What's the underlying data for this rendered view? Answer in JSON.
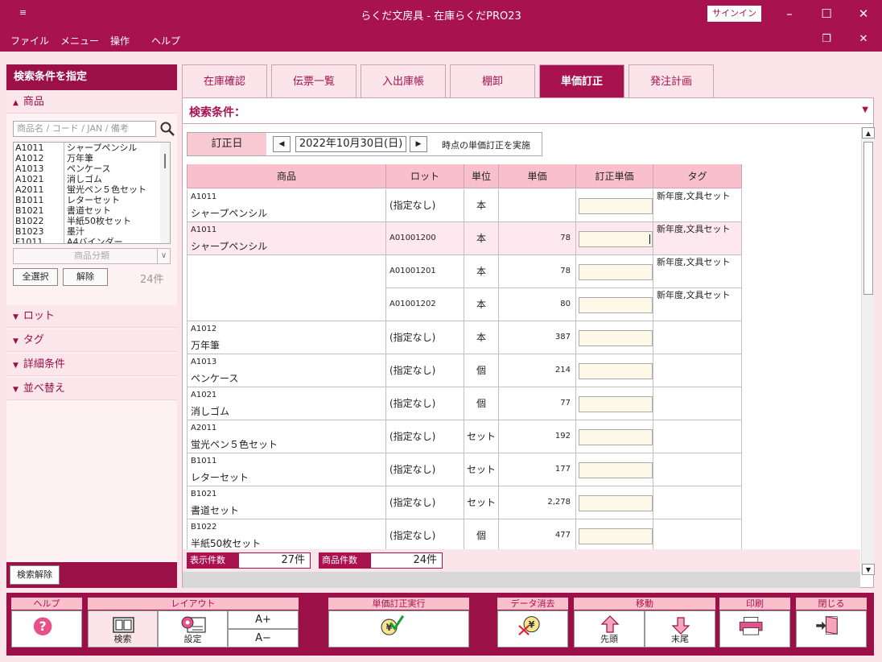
{
  "window": {
    "title": "らくだ文房具 - 在庫らくだPRO23",
    "signin_label": "サインイン",
    "system_glyph": "≡"
  },
  "menu": [
    "ファイル",
    "メニュー",
    "操作",
    "ヘルプ"
  ],
  "left_panel": {
    "header": "検索条件を指定",
    "product_section": "商品",
    "search_placeholder": "商品名 / コード / JAN / 備考",
    "products": [
      {
        "code": "A1011",
        "name": "シャープペンシル"
      },
      {
        "code": "A1012",
        "name": "万年筆"
      },
      {
        "code": "A1013",
        "name": "ペンケース"
      },
      {
        "code": "A1021",
        "name": "消しゴム"
      },
      {
        "code": "A2011",
        "name": "蛍光ペン５色セット"
      },
      {
        "code": "B1011",
        "name": "レターセット"
      },
      {
        "code": "B1021",
        "name": "書道セット"
      },
      {
        "code": "B1022",
        "name": "半紙50枚セット"
      },
      {
        "code": "B1023",
        "name": "墨汁"
      },
      {
        "code": "F1011",
        "name": "A4バインダー"
      }
    ],
    "category_placeholder": "商品分類",
    "select_all": "全選択",
    "clear": "解除",
    "count": "24件",
    "sections": [
      "ロット",
      "タグ",
      "詳細条件",
      "並べ替え"
    ],
    "clear_search": "検索解除"
  },
  "tabs": [
    {
      "label": "在庫確認",
      "active": false
    },
    {
      "label": "伝票一覧",
      "active": false
    },
    {
      "label": "入出庫帳",
      "active": false
    },
    {
      "label": "棚卸",
      "active": false
    },
    {
      "label": "単価訂正",
      "active": true
    },
    {
      "label": "発注計画",
      "active": false
    }
  ],
  "main": {
    "condition_label": "検索条件：",
    "date_label": "訂正日",
    "date_value": "2022年10月30日(日)",
    "date_note": "時点の単価訂正を実施",
    "columns": [
      "商品",
      "ロット",
      "単位",
      "単価",
      "訂正単価",
      "タグ"
    ],
    "rows": [
      {
        "code": "A1011",
        "name": "シャープペンシル",
        "lot": "(指定なし)",
        "unit": "本",
        "price": "",
        "tag": "新年度,文具セット",
        "show_product": true,
        "selected": false
      },
      {
        "code": "A1011",
        "name": "シャープペンシル",
        "lot": "A01001200",
        "unit": "本",
        "price": "78",
        "tag": "新年度,文具セット",
        "show_product": true,
        "selected": true
      },
      {
        "code": "",
        "name": "",
        "lot": "A01001201",
        "unit": "本",
        "price": "78",
        "tag": "新年度,文具セット",
        "show_product": false,
        "selected": false
      },
      {
        "code": "",
        "name": "",
        "lot": "A01001202",
        "unit": "本",
        "price": "80",
        "tag": "新年度,文具セット",
        "show_product": false,
        "selected": false
      },
      {
        "code": "A1012",
        "name": "万年筆",
        "lot": "(指定なし)",
        "unit": "本",
        "price": "387",
        "tag": "",
        "show_product": true,
        "selected": false
      },
      {
        "code": "A1013",
        "name": "ペンケース",
        "lot": "(指定なし)",
        "unit": "個",
        "price": "214",
        "tag": "",
        "show_product": true,
        "selected": false
      },
      {
        "code": "A1021",
        "name": "消しゴム",
        "lot": "(指定なし)",
        "unit": "個",
        "price": "77",
        "tag": "",
        "show_product": true,
        "selected": false
      },
      {
        "code": "A2011",
        "name": "蛍光ペン５色セット",
        "lot": "(指定なし)",
        "unit": "セット",
        "price": "192",
        "tag": "",
        "show_product": true,
        "selected": false
      },
      {
        "code": "B1011",
        "name": "レターセット",
        "lot": "(指定なし)",
        "unit": "セット",
        "price": "177",
        "tag": "",
        "show_product": true,
        "selected": false
      },
      {
        "code": "B1021",
        "name": "書道セット",
        "lot": "(指定なし)",
        "unit": "セット",
        "price": "2,278",
        "tag": "",
        "show_product": true,
        "selected": false
      },
      {
        "code": "B1022",
        "name": "半紙50枚セット",
        "lot": "(指定なし)",
        "unit": "個",
        "price": "477",
        "tag": "",
        "show_product": true,
        "selected": false
      }
    ],
    "status": {
      "display_label": "表示件数",
      "display_value": "27件",
      "product_label": "商品件数",
      "product_value": "24件"
    }
  },
  "toolbar": {
    "help_group": "ヘルプ",
    "layout_group": "レイアウト",
    "search": "検索",
    "settings": "設定",
    "font_up": "A+",
    "font_down": "A−",
    "execute_group": "単価訂正実行",
    "delete_group": "データ消去",
    "move_group": "移動",
    "first": "先頭",
    "last": "末尾",
    "print_group": "印刷",
    "close_group": "閉じる"
  }
}
